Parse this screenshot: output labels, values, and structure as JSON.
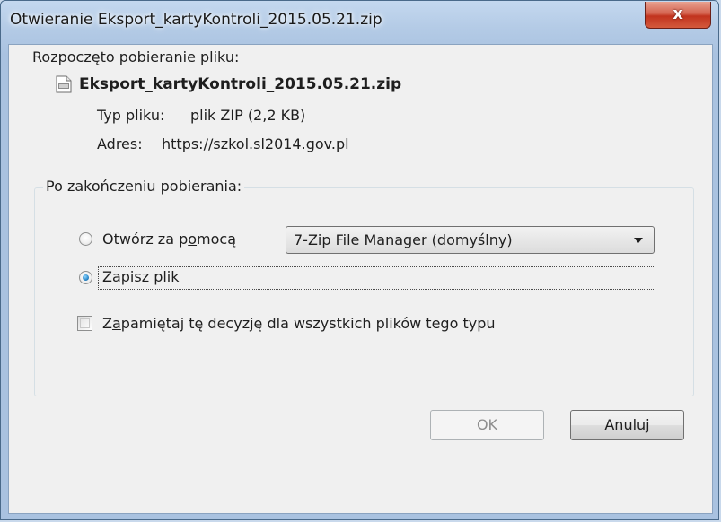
{
  "window": {
    "title": "Otwieranie Eksport_kartyKontroli_2015.05.21.zip",
    "close_label": "x"
  },
  "dialog": {
    "intro": "Rozpoczęto pobieranie pliku:",
    "filename": "Eksport_kartyKontroli_2015.05.21.zip",
    "file_icon": "zip-file-icon",
    "type_label": "Typ pliku:",
    "type_value": "plik ZIP (2,2 KB)",
    "address_label": "Adres:",
    "address_value": "https://szkol.sl2014.gov.pl"
  },
  "after_download": {
    "group_label": "Po zakończeniu pobierania:",
    "open_with": {
      "label_before": "Otwórz za p",
      "label_underlined": "o",
      "label_after": "mocą",
      "checked": false,
      "app_selected": "7-Zip File Manager (domyślny)"
    },
    "save_file": {
      "label_before": "Zapi",
      "label_underlined": "s",
      "label_after": "z plik",
      "checked": true
    },
    "remember": {
      "label_before": "Z",
      "label_underlined": "a",
      "label_after": "pamiętaj tę decyzję dla wszystkich plików tego typu",
      "checked": false
    }
  },
  "buttons": {
    "ok_label": "OK",
    "ok_enabled": false,
    "cancel_label": "Anuluj"
  }
}
